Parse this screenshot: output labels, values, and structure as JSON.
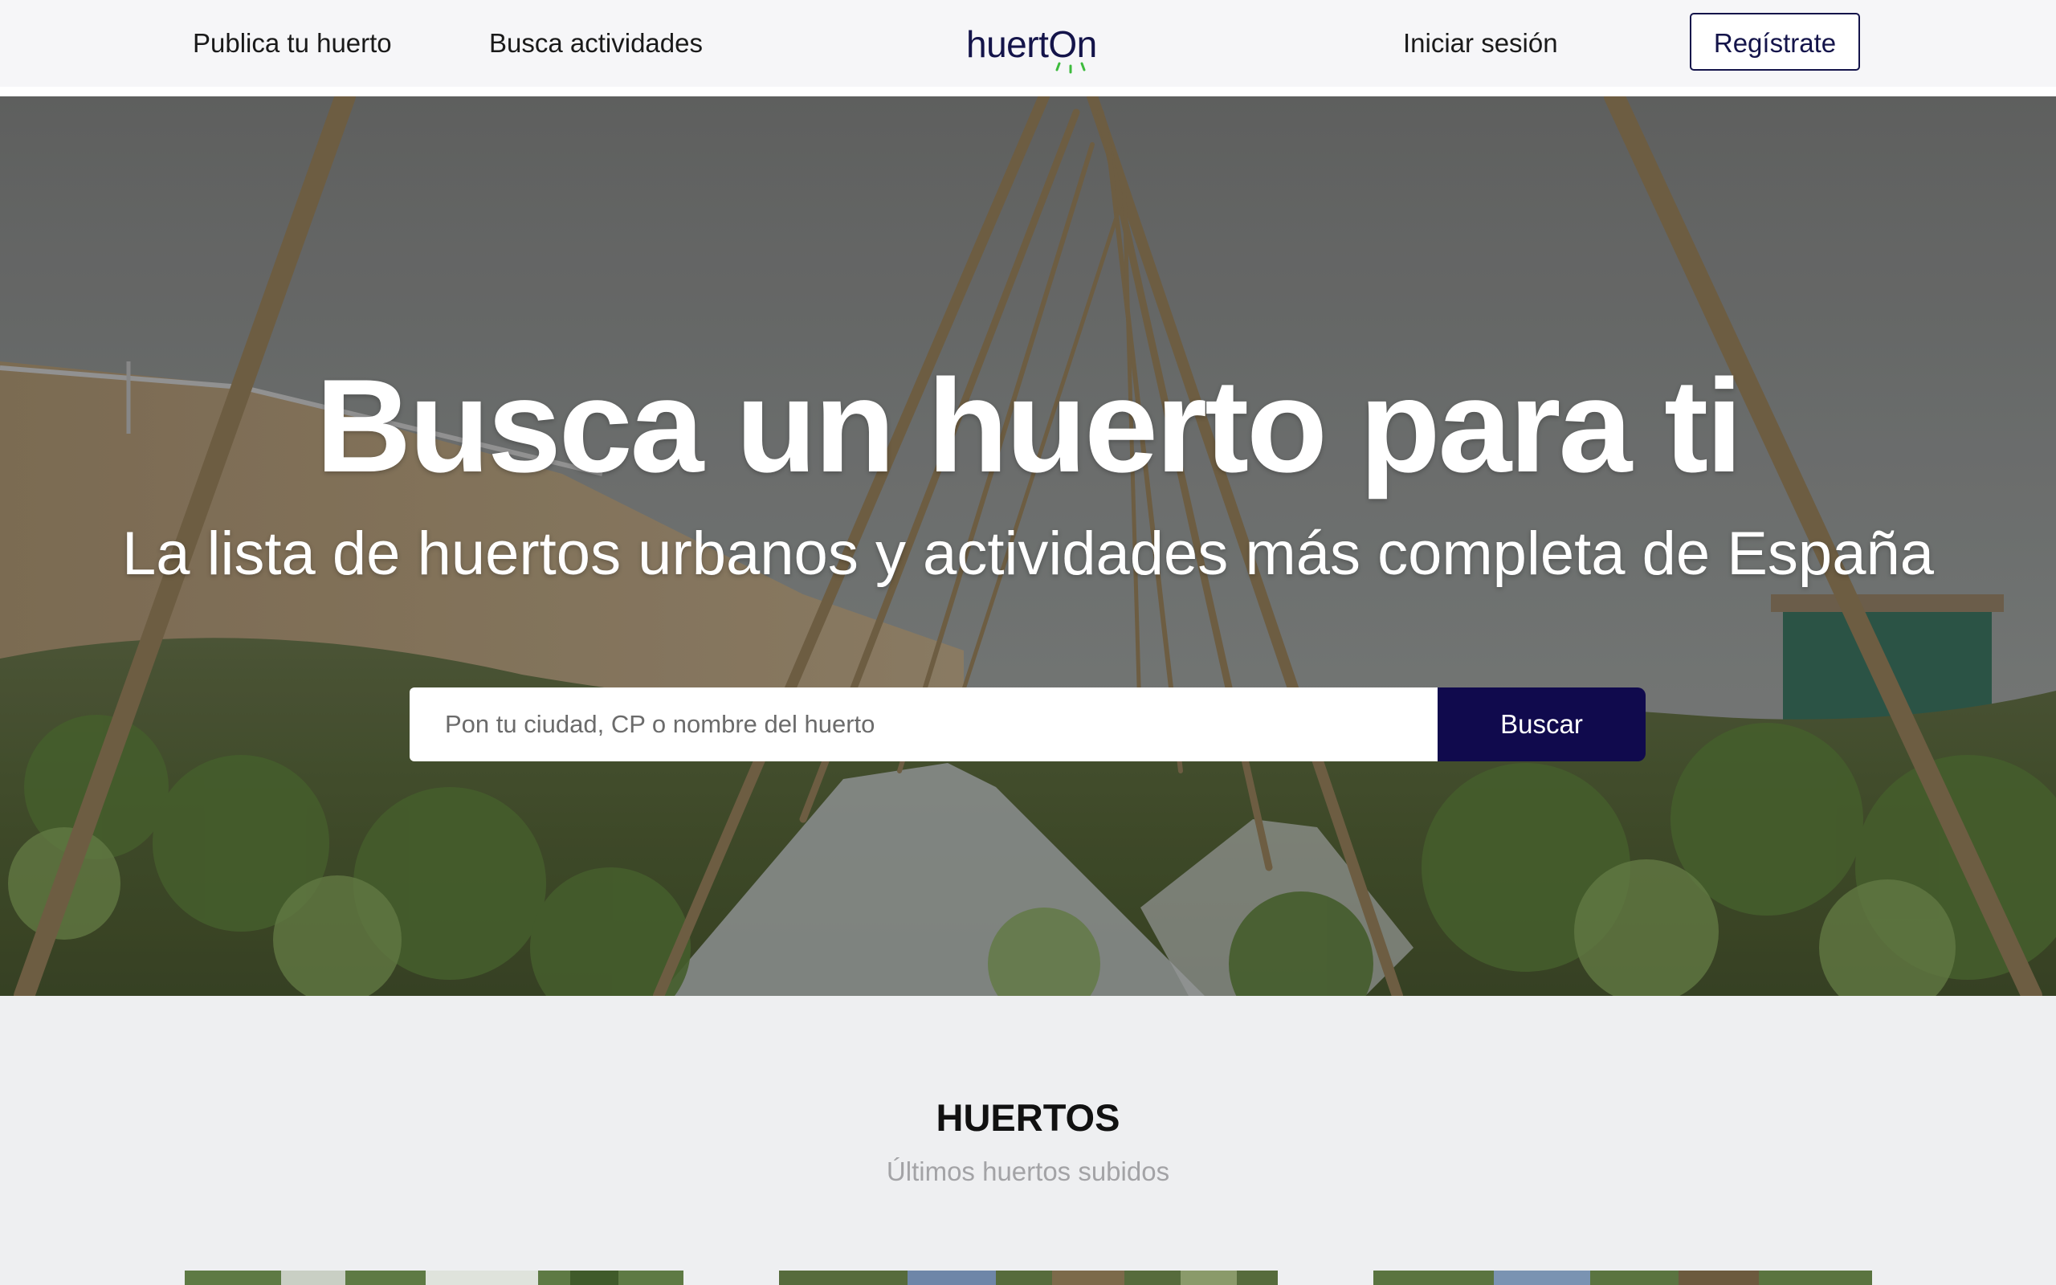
{
  "header": {
    "nav_publish": "Publica tu huerto",
    "nav_activities": "Busca actividades",
    "logo_text": "huertOn",
    "login": "Iniciar sesión",
    "register": "Regístrate"
  },
  "hero": {
    "title": "Busca un huerto para ti",
    "subtitle": "La lista de huertos urbanos y actividades más completa de España",
    "search_placeholder": "Pon tu ciudad, CP o nombre del huerto",
    "search_value": "",
    "search_button": "Buscar"
  },
  "section": {
    "title": "HUERTOS",
    "subtitle": "Últimos huertos subidos",
    "cards": [
      {
        "image": "garden-photo"
      },
      {
        "image": "garden-photo"
      },
      {
        "image": "garden-photo"
      }
    ]
  },
  "colors": {
    "brand_navy": "#100a4d",
    "logo_green": "#3dbb3d",
    "page_bg": "#eeeff1",
    "header_bg": "#f6f6f8"
  }
}
